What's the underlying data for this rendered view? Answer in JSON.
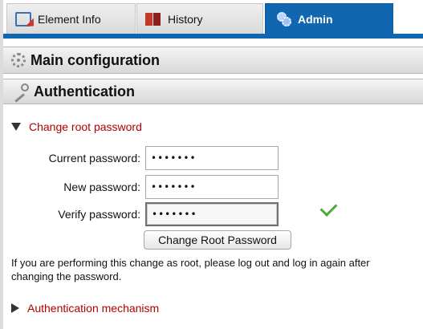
{
  "tabs": [
    {
      "label": "Element Info",
      "icon": "element-info-icon",
      "active": false
    },
    {
      "label": "History",
      "icon": "history-book-icon",
      "active": false
    },
    {
      "label": "Admin",
      "icon": "admin-gears-icon",
      "active": true
    }
  ],
  "sections": {
    "main_config": {
      "title": "Main configuration",
      "icon": "gear-icon"
    },
    "authentication": {
      "title": "Authentication",
      "icon": "key-icon"
    }
  },
  "change_password": {
    "expander_label": "Change root password",
    "expanded": true,
    "fields": {
      "current": {
        "label": "Current password:",
        "value": "•••••••"
      },
      "new": {
        "label": "New password:",
        "value": "•••••••"
      },
      "verify": {
        "label": "Verify password:",
        "value": "•••••••"
      }
    },
    "verified": true,
    "button_label": "Change Root Password",
    "note": "If you are performing this change as root, please log out and log in again after changing the password."
  },
  "auth_mechanism": {
    "expander_label": "Authentication mechanism",
    "expanded": false
  },
  "colors": {
    "accent": "#1166b0",
    "link_red": "#b00000",
    "check_green": "#52a838"
  }
}
